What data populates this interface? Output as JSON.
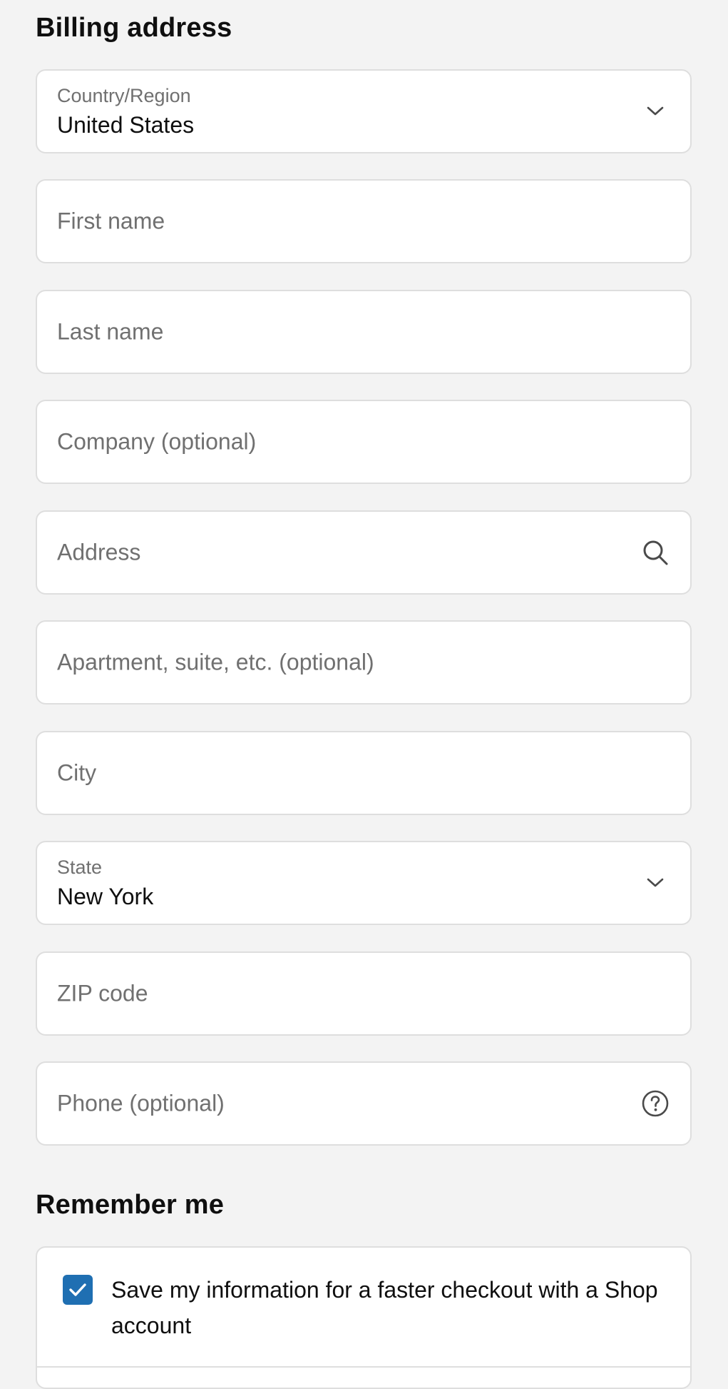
{
  "billing": {
    "title": "Billing address",
    "country": {
      "label": "Country/Region",
      "value": "United States",
      "icon": "chevron-down-icon"
    },
    "first_name": {
      "placeholder": "First name"
    },
    "last_name": {
      "placeholder": "Last name"
    },
    "company": {
      "placeholder": "Company (optional)"
    },
    "address": {
      "placeholder": "Address",
      "icon": "search-icon"
    },
    "apartment": {
      "placeholder": "Apartment, suite, etc. (optional)"
    },
    "city": {
      "placeholder": "City"
    },
    "state": {
      "label": "State",
      "value": "New York",
      "icon": "chevron-down-icon"
    },
    "zip": {
      "placeholder": "ZIP code"
    },
    "phone": {
      "placeholder": "Phone (optional)",
      "icon": "help-circle-icon"
    }
  },
  "remember": {
    "title": "Remember me",
    "checkbox_checked": true,
    "save_label": "Save my information for a faster checkout with a Shop account"
  },
  "colors": {
    "background": "#f3f3f3",
    "field_border": "#dedede",
    "checkbox": "#1f6fb2",
    "placeholder": "#707070"
  }
}
